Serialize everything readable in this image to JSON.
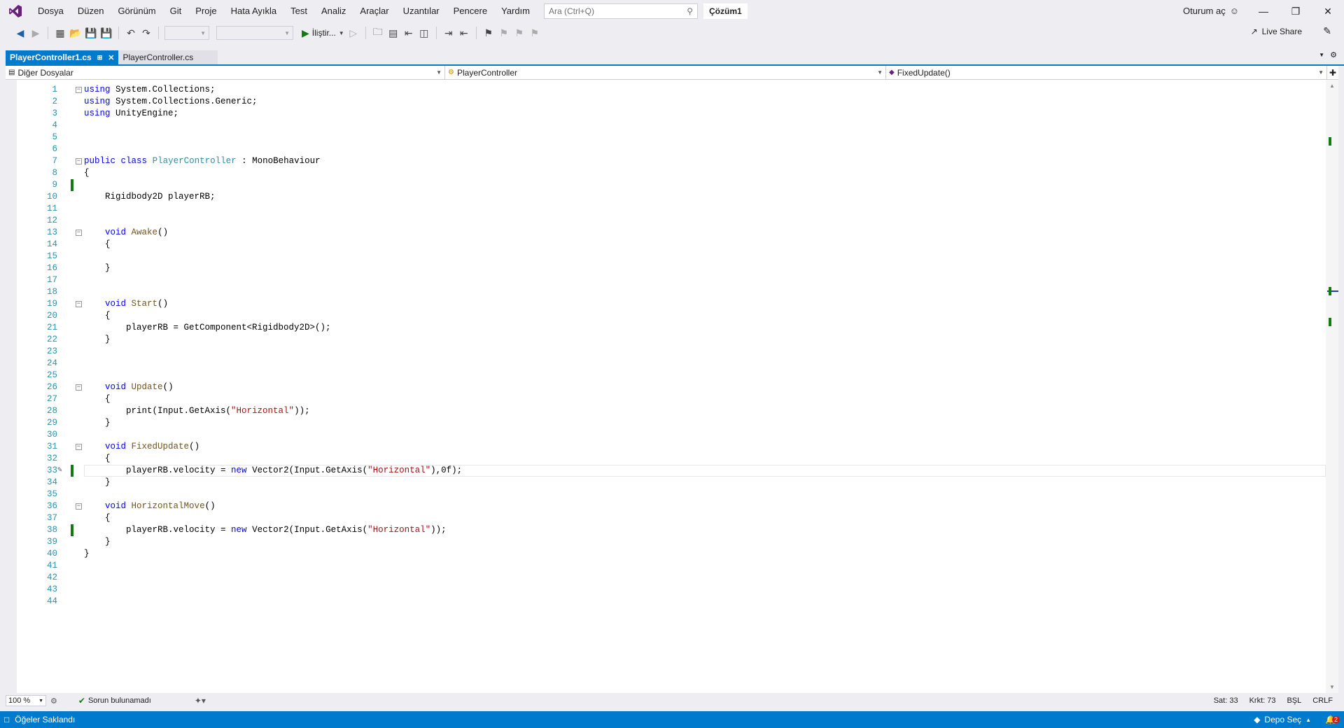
{
  "menubar": {
    "items": [
      "Dosya",
      "Düzen",
      "Görünüm",
      "Git",
      "Proje",
      "Hata Ayıkla",
      "Test",
      "Analiz",
      "Araçlar",
      "Uzantılar",
      "Pencere",
      "Yardım"
    ],
    "search_placeholder": "Ara (Ctrl+Q)",
    "solution_name": "Çözüm1",
    "signin_label": "Oturum aç"
  },
  "toolbar": {
    "run_label": "İliştir...",
    "liveshare_label": "Live Share"
  },
  "tabs": [
    {
      "label": "PlayerController1.cs",
      "active": true
    },
    {
      "label": "PlayerController.cs",
      "active": false
    }
  ],
  "navbar": {
    "project": "Diğer Dosyalar",
    "class": "PlayerController",
    "member": "FixedUpdate()"
  },
  "editor": {
    "lines": [
      "using System.Collections;",
      "using System.Collections.Generic;",
      "using UnityEngine;",
      "",
      "",
      "",
      "public class PlayerController : MonoBehaviour",
      "{",
      "",
      "    Rigidbody2D playerRB;",
      "",
      "",
      "    void Awake()",
      "    {",
      "",
      "    }",
      "",
      "",
      "    void Start()",
      "    {",
      "        playerRB = GetComponent<Rigidbody2D>();",
      "    }",
      "",
      "",
      "",
      "    void Update()",
      "    {",
      "        print(Input.GetAxis(\"Horizontal\"));",
      "    }",
      "",
      "    void FixedUpdate()",
      "    {",
      "        playerRB.velocity = new Vector2(Input.GetAxis(\"Horizontal\"),0f);",
      "    }",
      "",
      "    void HorizontalMove()",
      "    {",
      "        playerRB.velocity = new Vector2(Input.GetAxis(\"Horizontal\"));",
      "    }",
      "}",
      "",
      "",
      "",
      ""
    ],
    "changed_lines": [
      9,
      33,
      38
    ],
    "current_line": 33
  },
  "editstatus": {
    "zoom": "100 %",
    "issues": "Sorun bulunamadı",
    "line": "Sat: 33",
    "col": "Krkt: 73",
    "insert": "BŞL",
    "eol": "CRLF"
  },
  "statusbar": {
    "left": "Öğeler Saklandı",
    "repo": "Depo Seç",
    "notifications": "2"
  },
  "colors": {
    "accent": "#007acc",
    "change_marker": "#107c10",
    "keyword": "#0000ff",
    "type": "#2b91af",
    "string": "#a31515",
    "method": "#74531f"
  }
}
